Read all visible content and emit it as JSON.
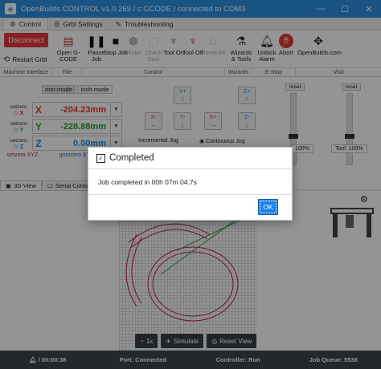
{
  "window": {
    "title": "OpenBuilds CONTROL v1.0.269 / c:GCODE / connected to COM3",
    "controls": [
      "—",
      "☐",
      "✕"
    ]
  },
  "tabs": [
    {
      "label": "Control",
      "icon": "gamepad-icon"
    },
    {
      "label": "Grbl Settings",
      "icon": "sliders-icon"
    },
    {
      "label": "Troubleshooting",
      "icon": "wrench-icon"
    }
  ],
  "ribbon": {
    "disconnect": "Disconnect",
    "restart": "Restart Grbl",
    "buttons": [
      {
        "label": "Open G-CODE",
        "icon": "folder-icon"
      },
      {
        "label": "Pause Job",
        "icon": "pause-icon"
      },
      {
        "label": "Stop Job",
        "icon": "stop-icon"
      },
      {
        "label": "Probe",
        "icon": "probe-icon"
      },
      {
        "label": "Check Size",
        "icon": "check-size-icon"
      },
      {
        "label": "Tool On",
        "icon": "spindle-on-icon"
      },
      {
        "label": "Tool Off",
        "icon": "spindle-off-icon"
      },
      {
        "label": "Home All",
        "icon": "home-icon"
      },
      {
        "label": "Wizards & Tools",
        "icon": "wizard-icon"
      },
      {
        "label": "Unlock Alarm",
        "icon": "bell-icon"
      },
      {
        "label": "Abort",
        "icon": "abort-icon"
      },
      {
        "label": "OpenBuilds.com",
        "icon": "openbuilds-icon"
      }
    ],
    "groups": [
      "Machine Interface",
      "File",
      "Control",
      "Wizards",
      "E-Stop",
      "Visit"
    ]
  },
  "dro": {
    "modes": [
      "mm-mode",
      "inch-mode"
    ],
    "setzero": "setzero",
    "axes": [
      {
        "axis": "X",
        "value": "-204.23mm",
        "color": "#e53935"
      },
      {
        "axis": "Y",
        "value": "-228.88mm",
        "color": "#2e9d3a"
      },
      {
        "axis": "Z",
        "value": "0.00mm",
        "color": "#1e88e5"
      }
    ],
    "setzero_xyz": "setzero XYZ",
    "goto_zero": "gotozero XYZ"
  },
  "jog": {
    "buttons": [
      "Y+",
      "X-",
      "X+",
      "Y-",
      "Z+",
      "Z-"
    ],
    "incremental": "Incremental Jog",
    "continuous": "Continuous Jog"
  },
  "overrides": {
    "reset": "reset",
    "feed": "100%",
    "tool": "Tool: 100%"
  },
  "secondary_tabs": [
    {
      "label": "3D View",
      "icon": "cube-icon"
    },
    {
      "label": "Serial Console",
      "icon": "terminal-icon"
    }
  ],
  "view": {
    "buttons": [
      {
        "label": "1x",
        "icon": "speed-icon"
      },
      {
        "label": "Simulate",
        "icon": "plane-icon"
      },
      {
        "label": "Reset View",
        "icon": "target-icon"
      }
    ]
  },
  "status": {
    "time": "0h:00:38",
    "port": "Port: Connected",
    "controller": "Controller: Run",
    "queue": "Job Queue: 5538"
  },
  "modal": {
    "title": "Completed",
    "message": "Job completed in 00h 07m 04.7s",
    "ok": "OK"
  }
}
